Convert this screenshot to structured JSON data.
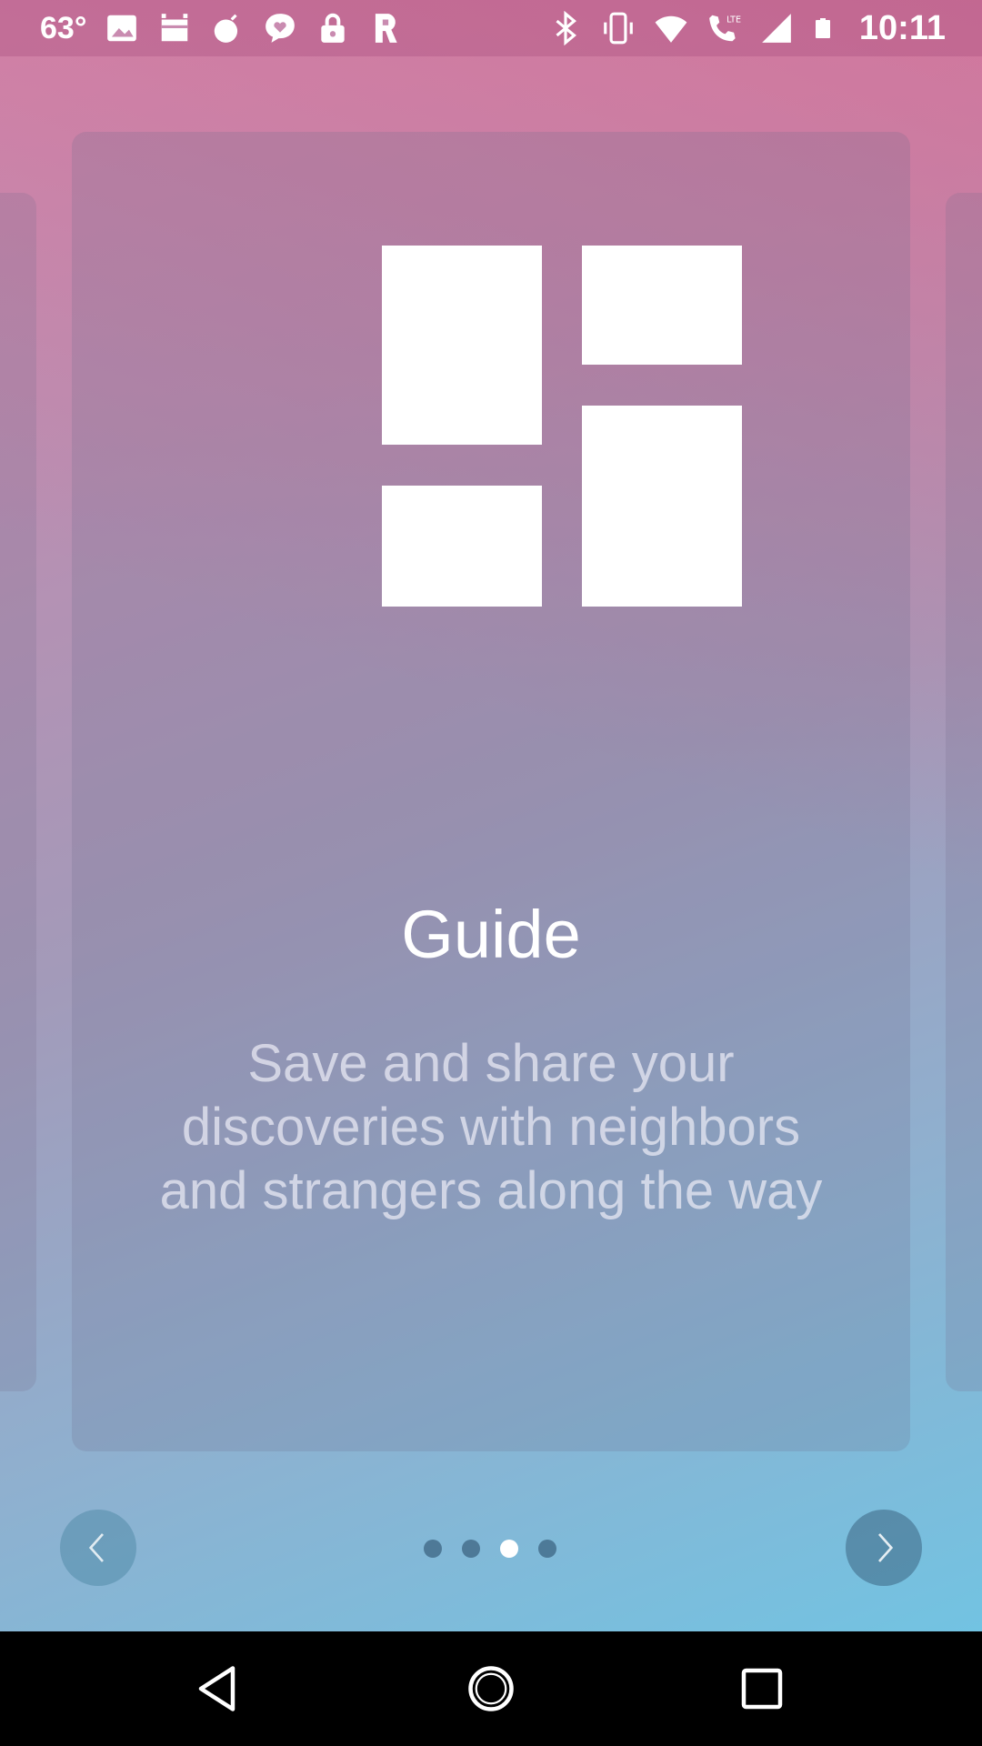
{
  "status_bar": {
    "temperature": "63°",
    "time": "10:11",
    "left_icons": [
      "image-icon",
      "android-debug-icon",
      "bomb-icon",
      "heart-message-icon",
      "lock-icon",
      "r-app-icon"
    ],
    "right_icons": [
      "bluetooth-icon",
      "vibrate-icon",
      "wifi-icon",
      "lte-call-icon",
      "signal-icon",
      "battery-icon"
    ]
  },
  "card": {
    "logo_icon": "grid-tiles-icon",
    "title": "Guide",
    "description": "Save and share your discoveries with neighbors and strangers along the way"
  },
  "pager": {
    "total_pages": 4,
    "current_page": 3,
    "prev_icon": "chevron-left-icon",
    "next_icon": "chevron-right-icon"
  },
  "nav_bar": {
    "back_icon": "back-triangle-icon",
    "home_icon": "home-circle-icon",
    "recents_icon": "recents-square-icon"
  },
  "colors": {
    "gradient_top": "#d9708f",
    "gradient_bottom": "#72c3e2",
    "text_primary": "#ffffff"
  }
}
